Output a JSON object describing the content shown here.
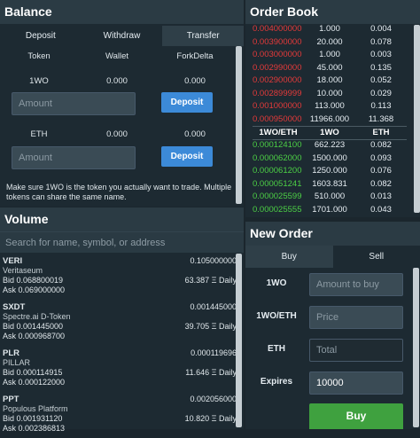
{
  "balance": {
    "title": "Balance",
    "tabs": [
      "Deposit",
      "Withdraw",
      "Transfer"
    ],
    "headers": [
      "Token",
      "Wallet",
      "ForkDelta"
    ],
    "rows": [
      {
        "token": "1WO",
        "wallet": "0.000",
        "forkdelta": "0.000",
        "placeholder": "Amount",
        "button": "Deposit"
      },
      {
        "token": "ETH",
        "wallet": "0.000",
        "forkdelta": "0.000",
        "placeholder": "Amount",
        "button": "Deposit"
      }
    ],
    "note": "Make sure 1WO is the token you actually want to trade. Multiple tokens can share the same name."
  },
  "volume": {
    "title": "Volume",
    "search_placeholder": "Search for name, symbol, or address",
    "items": [
      {
        "symbol": "VERI",
        "name": "Veritaseum",
        "price": "0.105000000",
        "bid": "Bid 0.068800019",
        "ask": "Ask 0.069000000",
        "daily": "63.387 Ξ Daily"
      },
      {
        "symbol": "SXDT",
        "name": "Spectre.ai D-Token",
        "price": "0.001445000",
        "bid": "Bid 0.001445000",
        "ask": "Ask 0.000968700",
        "daily": "39.705 Ξ Daily"
      },
      {
        "symbol": "PLR",
        "name": "PILLAR",
        "price": "0.000119696",
        "bid": "Bid 0.000114915",
        "ask": "Ask 0.000122000",
        "daily": "11.646 Ξ Daily"
      },
      {
        "symbol": "PPT",
        "name": "Populous Platform",
        "price": "0.002056000",
        "bid": "Bid 0.001931120",
        "ask": "Ask 0.002386813",
        "daily": "10.820 Ξ Daily"
      }
    ]
  },
  "orderbook": {
    "title": "Order Book",
    "headers": [
      "1WO/ETH",
      "1WO",
      "ETH"
    ],
    "sells": [
      [
        "0.004000000",
        "1.000",
        "0.004"
      ],
      [
        "0.003900000",
        "20.000",
        "0.078"
      ],
      [
        "0.003000000",
        "1.000",
        "0.003"
      ],
      [
        "0.002990000",
        "45.000",
        "0.135"
      ],
      [
        "0.002900000",
        "18.000",
        "0.052"
      ],
      [
        "0.002899999",
        "10.000",
        "0.029"
      ],
      [
        "0.001000000",
        "113.000",
        "0.113"
      ],
      [
        "0.000950000",
        "11966.000",
        "11.368"
      ]
    ],
    "buys": [
      [
        "0.000124100",
        "662.223",
        "0.082"
      ],
      [
        "0.000062000",
        "1500.000",
        "0.093"
      ],
      [
        "0.000061200",
        "1250.000",
        "0.076"
      ],
      [
        "0.000051241",
        "1603.831",
        "0.082"
      ],
      [
        "0.000025599",
        "510.000",
        "0.013"
      ],
      [
        "0.000025555",
        "1701.000",
        "0.043"
      ]
    ]
  },
  "neworder": {
    "title": "New Order",
    "tabs": [
      "Buy",
      "Sell"
    ],
    "fields": [
      {
        "label": "1WO",
        "placeholder": "Amount to buy"
      },
      {
        "label": "1WO/ETH",
        "placeholder": "Price"
      },
      {
        "label": "ETH",
        "placeholder": "Total"
      },
      {
        "label": "Expires",
        "value": "10000"
      }
    ],
    "buy_label": "Buy"
  }
}
